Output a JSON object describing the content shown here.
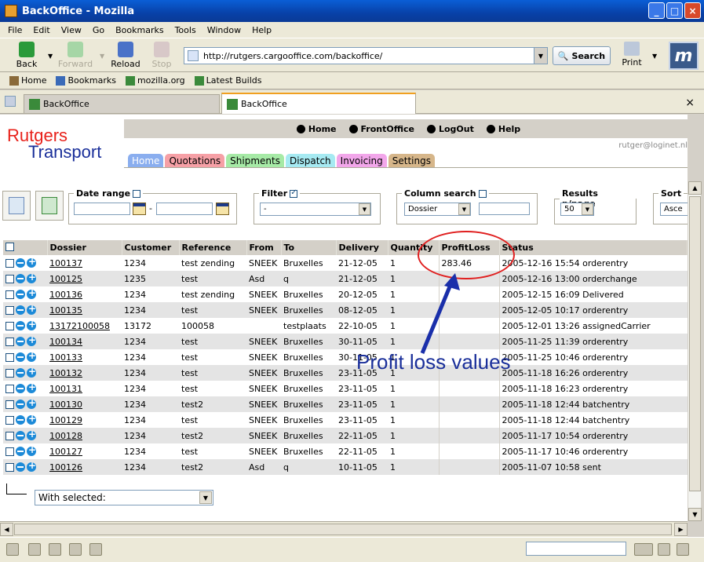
{
  "window": {
    "title": "BackOffice - Mozilla"
  },
  "menu": [
    "File",
    "Edit",
    "View",
    "Go",
    "Bookmarks",
    "Tools",
    "Window",
    "Help"
  ],
  "nav": {
    "back": "Back",
    "forward": "Forward",
    "reload": "Reload",
    "stop": "Stop",
    "url": "http://rutgers.cargooffice.com/backoffice/",
    "search": "Search",
    "print": "Print"
  },
  "bookmarks": [
    "Home",
    "Bookmarks",
    "mozilla.org",
    "Latest Builds"
  ],
  "tabs": [
    {
      "label": "BackOffice"
    },
    {
      "label": "BackOffice"
    }
  ],
  "logo": {
    "line1": "Rutgers",
    "line2": "Transport"
  },
  "topmenu": [
    "Home",
    "FrontOffice",
    "LogOut",
    "Help"
  ],
  "user_email": "rutger@loginet.nl",
  "app_tabs": [
    {
      "label": "Home",
      "color": "#8aaeef",
      "text": "#fff"
    },
    {
      "label": "Quotations",
      "color": "#f6a0a6",
      "text": "#000"
    },
    {
      "label": "Shipments",
      "color": "#a6eaa6",
      "text": "#000"
    },
    {
      "label": "Dispatch",
      "color": "#a6eaf2",
      "text": "#000"
    },
    {
      "label": "Invoicing",
      "color": "#f2a6ea",
      "text": "#000"
    },
    {
      "label": "Settings",
      "color": "#d6b68a",
      "text": "#000"
    }
  ],
  "filters": {
    "date_range": "Date range",
    "filter": "Filter",
    "filter_value": "-",
    "column_search": "Column search",
    "column_value": "Dossier",
    "results": "Results p/page",
    "results_value": "50",
    "sort": "Sort",
    "sort_value": "Asce"
  },
  "table": {
    "headers": [
      "Dossier",
      "Customer",
      "Reference",
      "From",
      "To",
      "Delivery",
      "Quantity",
      "ProfitLoss",
      "Status"
    ],
    "rows": [
      [
        "100137",
        "1234",
        "test zending",
        "SNEEK",
        "Bruxelles",
        "21-12-05",
        "1",
        "283.46",
        "2005-12-16 15:54 orderentry"
      ],
      [
        "100125",
        "1235",
        "test",
        "Asd",
        "q",
        "21-12-05",
        "1",
        "",
        "2005-12-16 13:00 orderchange"
      ],
      [
        "100136",
        "1234",
        "test zending",
        "SNEEK",
        "Bruxelles",
        "20-12-05",
        "1",
        "",
        "2005-12-15 16:09 Delivered"
      ],
      [
        "100135",
        "1234",
        "test",
        "SNEEK",
        "Bruxelles",
        "08-12-05",
        "1",
        "",
        "2005-12-05 10:17 orderentry"
      ],
      [
        "13172100058",
        "13172",
        "100058",
        "",
        "testplaats",
        "22-10-05",
        "1",
        "",
        "2005-12-01 13:26 assignedCarrier"
      ],
      [
        "100134",
        "1234",
        "test",
        "SNEEK",
        "Bruxelles",
        "30-11-05",
        "1",
        "",
        "2005-11-25 11:39 orderentry"
      ],
      [
        "100133",
        "1234",
        "test",
        "SNEEK",
        "Bruxelles",
        "30-11-05",
        "1",
        "",
        "2005-11-25 10:46 orderentry"
      ],
      [
        "100132",
        "1234",
        "test",
        "SNEEK",
        "Bruxelles",
        "23-11-05",
        "1",
        "",
        "2005-11-18 16:26 orderentry"
      ],
      [
        "100131",
        "1234",
        "test",
        "SNEEK",
        "Bruxelles",
        "23-11-05",
        "1",
        "",
        "2005-11-18 16:23 orderentry"
      ],
      [
        "100130",
        "1234",
        "test2",
        "SNEEK",
        "Bruxelles",
        "23-11-05",
        "1",
        "",
        "2005-11-18 12:44 batchentry"
      ],
      [
        "100129",
        "1234",
        "test",
        "SNEEK",
        "Bruxelles",
        "23-11-05",
        "1",
        "",
        "2005-11-18 12:44 batchentry"
      ],
      [
        "100128",
        "1234",
        "test2",
        "SNEEK",
        "Bruxelles",
        "22-11-05",
        "1",
        "",
        "2005-11-17 10:54 orderentry"
      ],
      [
        "100127",
        "1234",
        "test",
        "SNEEK",
        "Bruxelles",
        "22-11-05",
        "1",
        "",
        "2005-11-17 10:46 orderentry"
      ],
      [
        "100126",
        "1234",
        "test2",
        "Asd",
        "q",
        "10-11-05",
        "1",
        "",
        "2005-11-07 10:58 sent"
      ]
    ]
  },
  "with_selected": "With selected:",
  "annotation": "Profit loss values"
}
